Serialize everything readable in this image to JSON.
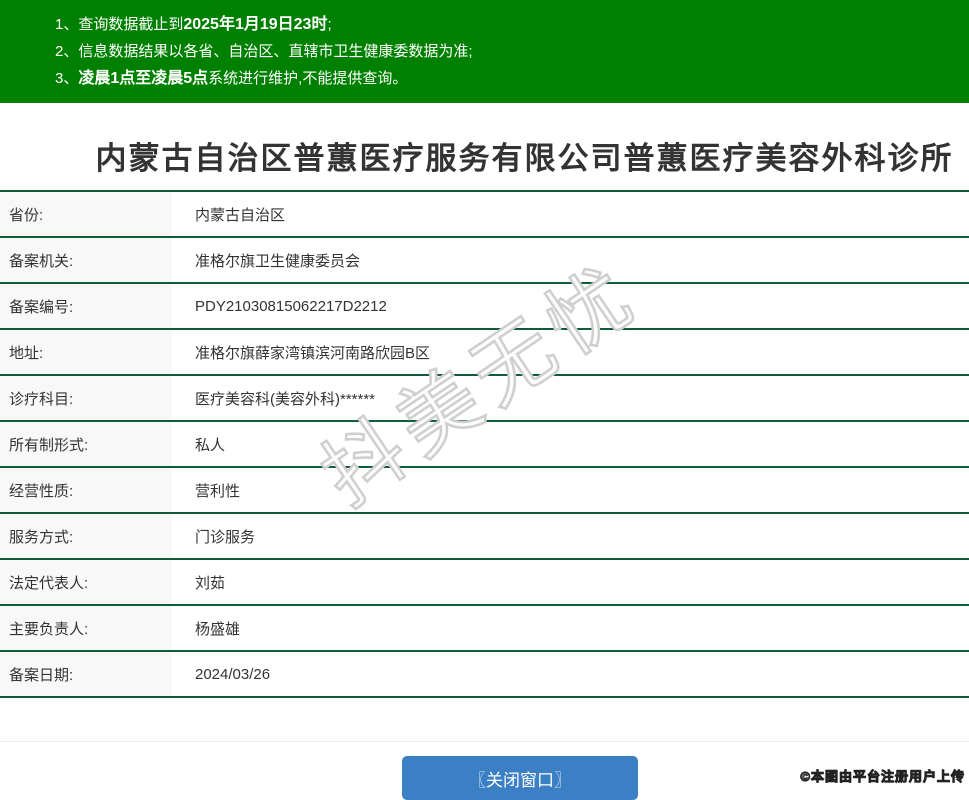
{
  "banner": {
    "bg_color": "#008000",
    "notices": [
      {
        "num": "1、",
        "pre": "查询数据截止到",
        "bold": "2025年1月19日23时",
        "post": ";"
      },
      {
        "num": "2、",
        "pre": "信息数据结果以各省、自治区、直辖市卫生健康委数据为准;",
        "bold": "",
        "post": ""
      },
      {
        "num": "3、",
        "pre": "",
        "bold": "凌晨1点至凌晨5点",
        "post": "系统进行维护,不能提供查询。"
      }
    ]
  },
  "title": "内蒙古自治区普蕙医疗服务有限公司普蕙医疗美容外科诊所",
  "table": {
    "rows": [
      {
        "label": "省份:",
        "value": "内蒙古自治区"
      },
      {
        "label": "备案机关:",
        "value": "准格尔旗卫生健康委员会"
      },
      {
        "label": "备案编号:",
        "value": "PDY21030815062217D2212"
      },
      {
        "label": "地址:",
        "value": "准格尔旗薛家湾镇滨河南路欣园B区"
      },
      {
        "label": "诊疗科目:",
        "value": "医疗美容科(美容外科)******"
      },
      {
        "label": "所有制形式:",
        "value": "私人"
      },
      {
        "label": "经营性质:",
        "value": "营利性"
      },
      {
        "label": "服务方式:",
        "value": "门诊服务"
      },
      {
        "label": "法定代表人:",
        "value": "刘茹"
      },
      {
        "label": "主要负责人:",
        "value": "杨盛雄"
      },
      {
        "label": "备案日期:",
        "value": "2024/03/26"
      }
    ]
  },
  "watermark": "抖美无忧",
  "close_button_label": "〖关闭窗口〗",
  "copyright": "©本图由平台注册用户上传",
  "colors": {
    "banner_green": "#008000",
    "table_line_green": "#0e5c3a",
    "label_bg": "#f8f8f8",
    "button_blue": "#3b80c4",
    "text": "#333333"
  }
}
